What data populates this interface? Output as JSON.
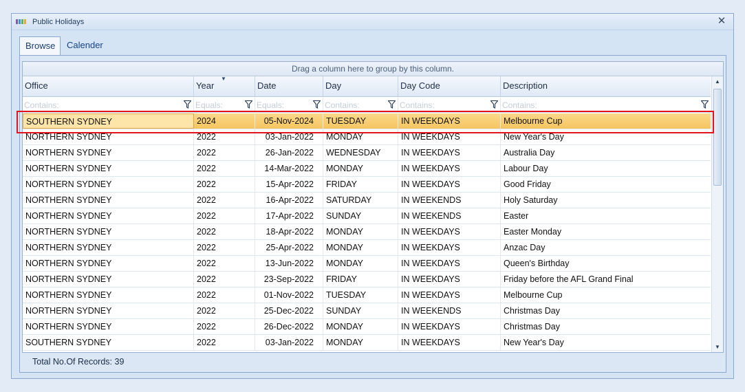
{
  "window": {
    "title": "Public Holidays",
    "icon": "app-logo-icon",
    "close_glyph": "✕"
  },
  "tabs": [
    {
      "label": "Browse",
      "active": true
    },
    {
      "label": "Calender",
      "active": false
    }
  ],
  "grid": {
    "group_panel_text": "Drag a column here to group by this column.",
    "columns": [
      {
        "key": "office",
        "label": "Office",
        "filter_placeholder": "Contains:"
      },
      {
        "key": "year",
        "label": "Year",
        "filter_placeholder": "Equals:"
      },
      {
        "key": "date",
        "label": "Date",
        "filter_placeholder": "Equals:"
      },
      {
        "key": "day",
        "label": "Day",
        "filter_placeholder": "Contains:"
      },
      {
        "key": "day_code",
        "label": "Day Code",
        "filter_placeholder": "Contains:"
      },
      {
        "key": "description",
        "label": "Description",
        "filter_placeholder": "Contains:"
      }
    ],
    "sort_glyph": "▼",
    "rows": [
      [
        "SOUTHERN SYDNEY",
        "2024",
        "05-Nov-2024",
        "TUESDAY",
        "IN WEEKDAYS",
        "Melbourne Cup"
      ],
      [
        "NORTHERN SYDNEY",
        "2022",
        "03-Jan-2022",
        "MONDAY",
        "IN WEEKDAYS",
        "New Year's Day"
      ],
      [
        "NORTHERN SYDNEY",
        "2022",
        "26-Jan-2022",
        "WEDNESDAY",
        "IN WEEKDAYS",
        "Australia Day"
      ],
      [
        "NORTHERN SYDNEY",
        "2022",
        "14-Mar-2022",
        "MONDAY",
        "IN WEEKDAYS",
        "Labour Day"
      ],
      [
        "NORTHERN SYDNEY",
        "2022",
        "15-Apr-2022",
        "FRIDAY",
        "IN WEEKDAYS",
        "Good Friday"
      ],
      [
        "NORTHERN SYDNEY",
        "2022",
        "16-Apr-2022",
        "SATURDAY",
        "IN WEEKENDS",
        "Holy Saturday"
      ],
      [
        "NORTHERN SYDNEY",
        "2022",
        "17-Apr-2022",
        "SUNDAY",
        "IN WEEKENDS",
        "Easter"
      ],
      [
        "NORTHERN SYDNEY",
        "2022",
        "18-Apr-2022",
        "MONDAY",
        "IN WEEKDAYS",
        "Easter Monday"
      ],
      [
        "NORTHERN SYDNEY",
        "2022",
        "25-Apr-2022",
        "MONDAY",
        "IN WEEKDAYS",
        "Anzac Day"
      ],
      [
        "NORTHERN SYDNEY",
        "2022",
        "13-Jun-2022",
        "MONDAY",
        "IN WEEKDAYS",
        "Queen's Birthday"
      ],
      [
        "NORTHERN SYDNEY",
        "2022",
        "23-Sep-2022",
        "FRIDAY",
        "IN WEEKDAYS",
        "Friday before the AFL Grand Final"
      ],
      [
        "NORTHERN SYDNEY",
        "2022",
        "01-Nov-2022",
        "TUESDAY",
        "IN WEEKDAYS",
        "Melbourne Cup"
      ],
      [
        "NORTHERN SYDNEY",
        "2022",
        "25-Dec-2022",
        "SUNDAY",
        "IN WEEKENDS",
        "Christmas Day"
      ],
      [
        "NORTHERN SYDNEY",
        "2022",
        "26-Dec-2022",
        "MONDAY",
        "IN WEEKDAYS",
        "Christmas Day"
      ],
      [
        "SOUTHERN SYDNEY",
        "2022",
        "03-Jan-2022",
        "MONDAY",
        "IN WEEKDAYS",
        "New Year's Day"
      ]
    ],
    "selected_row": 0,
    "scroll_up_glyph": "▲",
    "scroll_down_glyph": "▼"
  },
  "status": {
    "total_records": "Total No.Of Records: 39"
  },
  "colors": {
    "selected_row": "#f6c560",
    "highlight_outline": "#e2141b",
    "window_border": "#8aa8cf"
  }
}
